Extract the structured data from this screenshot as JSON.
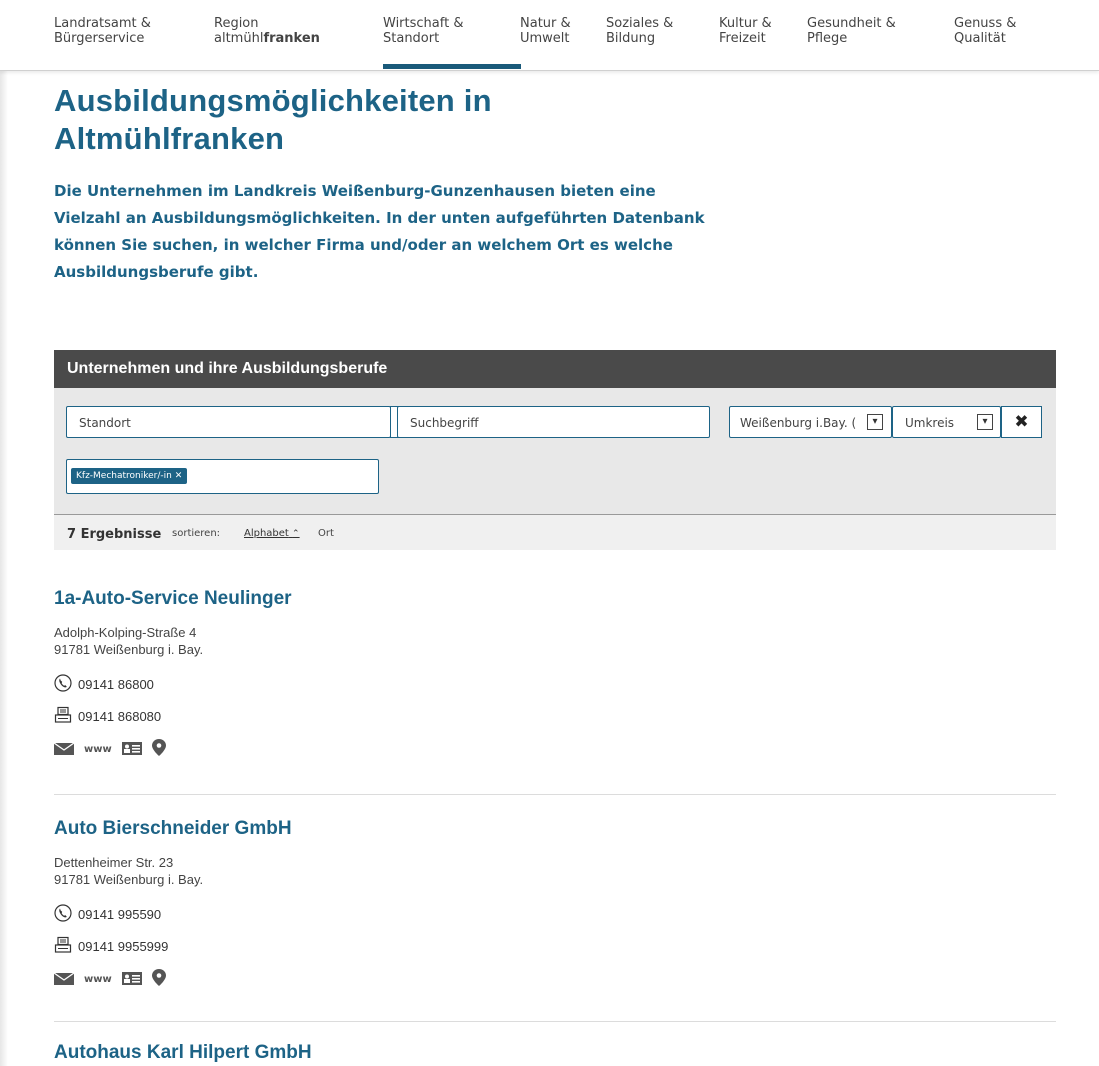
{
  "nav": [
    {
      "line1": "Landratsamt &",
      "line2": "Bürgerservice"
    },
    {
      "line1": "Region",
      "line2a": "altmühl",
      "line2b": "franken"
    },
    {
      "line1": "Wirtschaft &",
      "line2": "Standort",
      "active": true
    },
    {
      "line1": "Natur &",
      "line2": "Umwelt"
    },
    {
      "line1": "Soziales &",
      "line2": "Bildung"
    },
    {
      "line1": "Kultur &",
      "line2": "Freizeit"
    },
    {
      "line1": "Gesundheit &",
      "line2": "Pflege"
    },
    {
      "line1": "Genuss &",
      "line2": "Qualität"
    }
  ],
  "page": {
    "title": "Ausbildungsmöglichkeiten in Altmühlfranken",
    "intro": "Die Unternehmen im Landkreis Weißenburg-Gunzenhausen bieten eine Vielzahl an Ausbildungsmöglichkeiten. In der unten aufgeführten Datenbank können Sie suchen, in welcher Firma und/oder an welchem Ort es welche Ausbildungsberufe gibt."
  },
  "search": {
    "header": "Unternehmen und ihre Ausbildungsberufe",
    "standort_placeholder": "Standort",
    "suchbegriff_placeholder": "Suchbegriff",
    "city_value": "Weißenburg i.Bay. (",
    "umkreis_value": "Umkreis",
    "tag": "Kfz-Mechatroniker/-in ✕",
    "results_count": "7 Ergebnisse",
    "sort_label": "sortieren:",
    "sort_alpha": "Alphabet",
    "sort_ort": "Ort"
  },
  "companies": [
    {
      "name": "1a-Auto-Service Neulinger",
      "street": "Adolph-Kolping-Straße 4",
      "city": "91781 Weißenburg i. Bay.",
      "phone": "09141 86800",
      "fax": "09141 868080"
    },
    {
      "name": "Auto Bierschneider GmbH",
      "street": "Dettenheimer Str. 23",
      "city": "91781 Weißenburg i. Bay.",
      "phone": "09141 995590",
      "fax": "09141 9955999"
    },
    {
      "name": "Autohaus Karl Hilpert GmbH"
    }
  ],
  "icons": {
    "www": "www"
  },
  "colors": {
    "accent": "#1d6386",
    "header_bg": "#4a4a4a",
    "panel_bg": "#e8e8e8"
  }
}
